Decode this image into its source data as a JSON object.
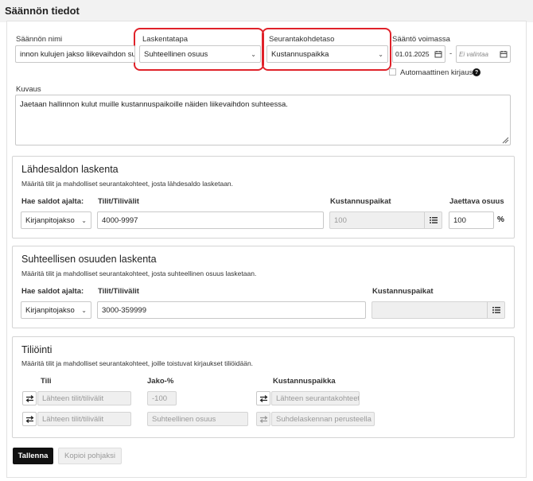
{
  "page": {
    "title": "Säännön tiedot"
  },
  "rule": {
    "name_label": "Säännön nimi",
    "name_value": "innon kulujen jakso liikevaihdon suh",
    "calc_label": "Laskentatapa",
    "calc_value": "Suhteellinen osuus",
    "tracking_label": "Seurantakohdetaso",
    "tracking_value": "Kustannuspaikka",
    "validity_label": "Sääntö voimassa",
    "valid_from": "01.01.2025",
    "dash": "-",
    "valid_to_placeholder": "Ei valintaa",
    "auto_label": "Automaattinen kirjaus",
    "auto_checked": false,
    "desc_label": "Kuvaus",
    "desc_value": "Jaetaan hallinnon kulut muille kustannuspaikoille näiden liikevaihdon suhteessa."
  },
  "source": {
    "title": "Lähdesaldon laskenta",
    "desc": "Määritä tilit ja mahdolliset seurantakohteet, josta lähdesaldo lasketaan.",
    "fetch_label": "Hae saldot ajalta:",
    "accounts_label": "Tilit/Tilivälit",
    "cost_label": "Kustannuspaikat",
    "share_label": "Jaettava osuus",
    "fetch_value": "Kirjanpitojakso",
    "accounts_value": "4000-9997",
    "cost_value": "100",
    "share_value": "100",
    "percent": "%"
  },
  "relative": {
    "title": "Suhteellisen osuuden laskenta",
    "desc": "Määritä tilit ja mahdolliset seurantakohteet, josta suhteellinen osuus lasketaan.",
    "fetch_label": "Hae saldot ajalta:",
    "accounts_label": "Tilit/Tilivälit",
    "cost_label": "Kustannuspaikat",
    "fetch_value": "Kirjanpitojakso",
    "accounts_value": "3000-359999",
    "cost_value": ""
  },
  "posting": {
    "title": "Tiliöinti",
    "desc": "Määritä tilit ja mahdolliset seurantakohteet, joille toistuvat kirjaukset tiliöidään.",
    "col_account": "Tili",
    "col_share": "Jako-%",
    "col_cost": "Kustannuspaikka",
    "rows": [
      {
        "account": "Lähteen tilit/tilivälit",
        "share": "-100",
        "cost": "Lähteen seurantakohteet"
      },
      {
        "account": "Lähteen tilit/tilivälit",
        "share": "Suhteellinen osuus",
        "cost": "Suhdelaskennan perusteella"
      }
    ]
  },
  "actions": {
    "save": "Tallenna",
    "copy": "Kopioi pohjaksi"
  },
  "colors": {
    "highlight": "#e0222a",
    "primary_button": "#111111"
  }
}
